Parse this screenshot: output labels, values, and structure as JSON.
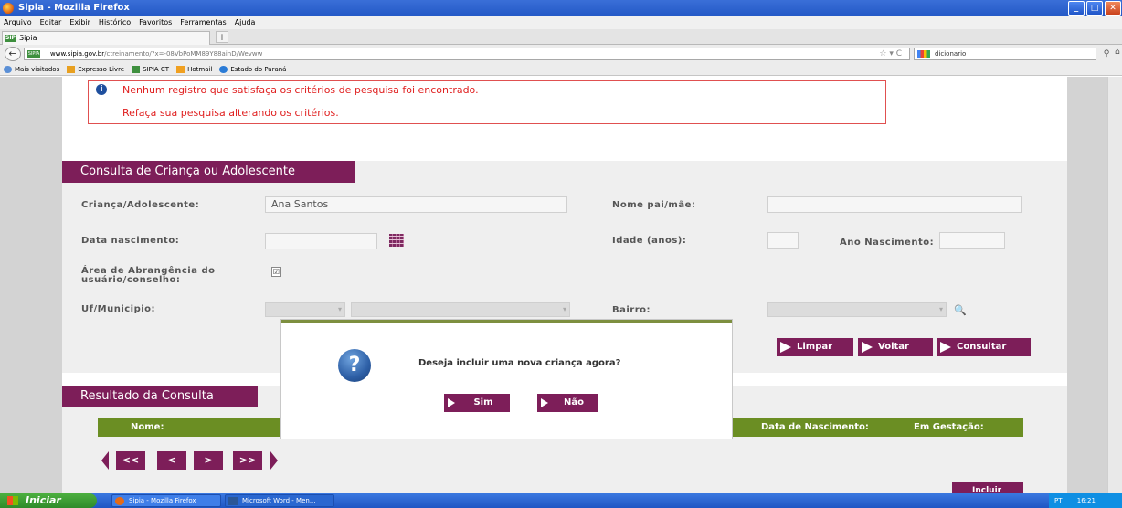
{
  "browser": {
    "window_title": "Sipia - Mozilla Firefox",
    "menu": [
      "Arquivo",
      "Editar",
      "Exibir",
      "Histórico",
      "Favoritos",
      "Ferramentas",
      "Ajuda"
    ],
    "tab_title": "Sipia",
    "tab_badge": "SIPIA",
    "url_domain": "www.sipia.gov.br",
    "url_path": "/ctreinamento/?x=-08VbPoMM89Y88ainD/Wevww",
    "search_value": "dicionario",
    "bookmarks": [
      "Mais visitados",
      "Expresso Livre",
      "SIPIA CT",
      "Hotmail",
      "Estado do Paraná"
    ]
  },
  "error": {
    "line1": "Nenhum registro que satisfaça os critérios de pesquisa foi encontrado.",
    "line2": "Refaça sua pesquisa alterando os critérios."
  },
  "search_form": {
    "title": "Consulta de Criança ou Adolescente",
    "crianca_label": "Criança/Adolescente:",
    "crianca_value": "Ana Santos",
    "nome_pai_mae_label": "Nome pai/mãe:",
    "data_nascimento_label": "Data nascimento:",
    "idade_label": "Idade (anos):",
    "ano_nascimento_label": "Ano Nascimento:",
    "area_label_1": "Área de Abrangência do",
    "area_label_2": "usuário/conselho:",
    "area_checked": "☑",
    "uf_label": "Uf/Municipio:",
    "bairro_label": "Bairro:",
    "btn_limpar": "Limpar",
    "btn_voltar": "Voltar",
    "btn_consultar": "Consultar"
  },
  "results": {
    "title": "Resultado da Consulta",
    "columns": [
      "Nome:",
      "Data de Nascimento:",
      "Em Gestação:"
    ],
    "pager": [
      "<<",
      "<",
      ">",
      ">>"
    ],
    "btn_incluir": "Incluir"
  },
  "modal": {
    "question": "Deseja incluir uma nova criança agora?",
    "icon_glyph": "?",
    "btn_sim": "Sim",
    "btn_nao": "Não"
  },
  "taskbar": {
    "start": "Iniciar",
    "tasks": [
      "Sipia - Mozilla Firefox",
      "Microsoft Word - Men..."
    ],
    "lang": "PT",
    "clock": "16:21"
  },
  "colors": {
    "primary": "#7d1e59",
    "table_header": "#6b8e23",
    "error": "#e02020"
  }
}
